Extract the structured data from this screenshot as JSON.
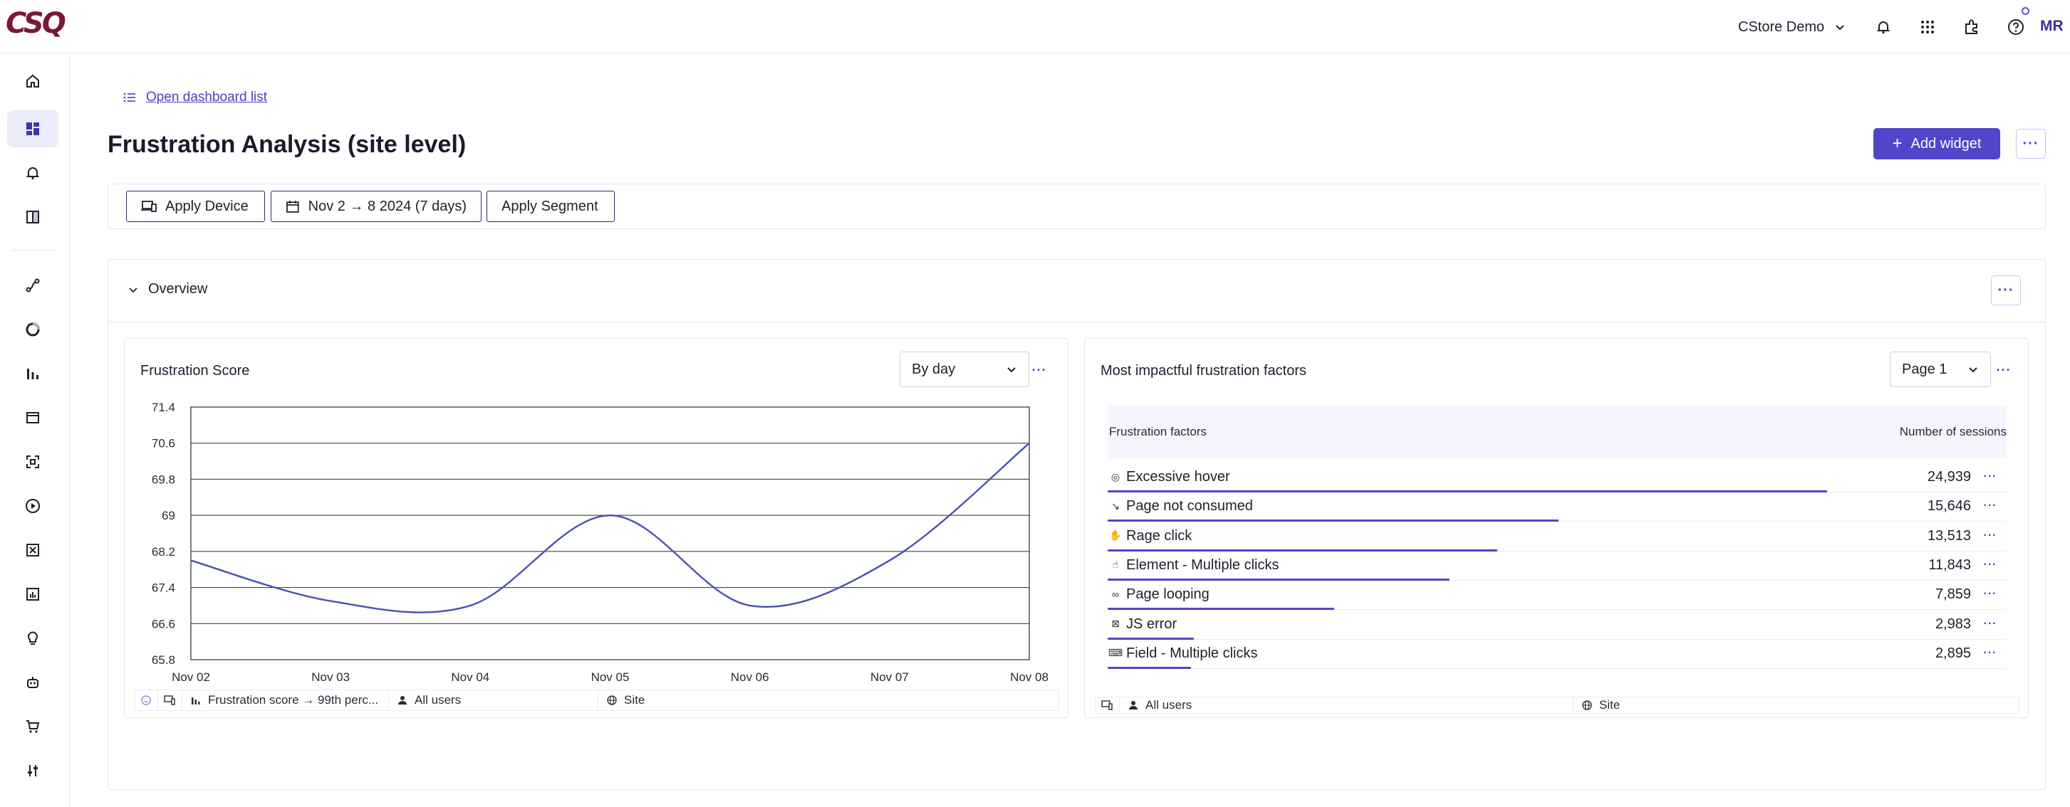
{
  "app": {
    "logo": "CSQ",
    "org": "CStore Demo",
    "avatar_initials": "MR"
  },
  "nav": {
    "open_dashboard_list": "Open dashboard list"
  },
  "page": {
    "title": "Frustration Analysis (site level)",
    "add_widget_label": "Add widget"
  },
  "filters": {
    "device": "Apply Device",
    "date_range": "Nov 2 → 8 2024 (7 days)",
    "segment": "Apply Segment"
  },
  "overview": {
    "label": "Overview"
  },
  "frustration_widget": {
    "title": "Frustration Score",
    "granularity": "By day",
    "footer": {
      "metric": "Frustration score → 99th perc...",
      "audience": "All users",
      "scope": "Site"
    }
  },
  "factors_widget": {
    "title": "Most impactful frustration factors",
    "page_select": "Page 1",
    "col_factor": "Frustration factors",
    "col_sessions": "Number of sessions",
    "rows": [
      {
        "icon": "hover-icon",
        "glyph": "◎",
        "label": "Excessive hover",
        "value": "24,939",
        "share": 1.0
      },
      {
        "icon": "page-not-consumed-icon",
        "glyph": "↘",
        "label": "Page not consumed",
        "value": "15,646",
        "share": 0.627
      },
      {
        "icon": "rage-click-icon",
        "glyph": "✋",
        "label": "Rage click",
        "value": "13,513",
        "share": 0.542
      },
      {
        "icon": "multiple-clicks-icon",
        "glyph": "☝",
        "label": "Element - Multiple clicks",
        "value": "11,843",
        "share": 0.475
      },
      {
        "icon": "page-looping-icon",
        "glyph": "∞",
        "label": "Page looping",
        "value": "7,859",
        "share": 0.315
      },
      {
        "icon": "js-error-icon",
        "glyph": "⊠",
        "label": "JS error",
        "value": "2,983",
        "share": 0.12
      },
      {
        "icon": "field-multiple-clicks-icon",
        "glyph": "⌨",
        "label": "Field - Multiple clicks",
        "value": "2,895",
        "share": 0.116
      }
    ],
    "footer": {
      "audience": "All users",
      "scope": "Site"
    }
  },
  "chart_data": {
    "type": "line",
    "title": "Frustration Score",
    "x": [
      "Nov 02",
      "Nov 03",
      "Nov 04",
      "Nov 05",
      "Nov 06",
      "Nov 07",
      "Nov 08"
    ],
    "series": [
      {
        "values": [
          68.0,
          67.1,
          67.0,
          69.0,
          67.0,
          68.0,
          70.6
        ]
      }
    ],
    "yticks": [
      "71.4",
      "70.6",
      "69.8",
      "69",
      "68.2",
      "67.4",
      "66.6",
      "65.8"
    ],
    "ylim": [
      65.8,
      71.4
    ],
    "grid": true,
    "color": "#4a50b8"
  },
  "colors": {
    "accent": "#5046c9",
    "brand": "#7a1838"
  }
}
